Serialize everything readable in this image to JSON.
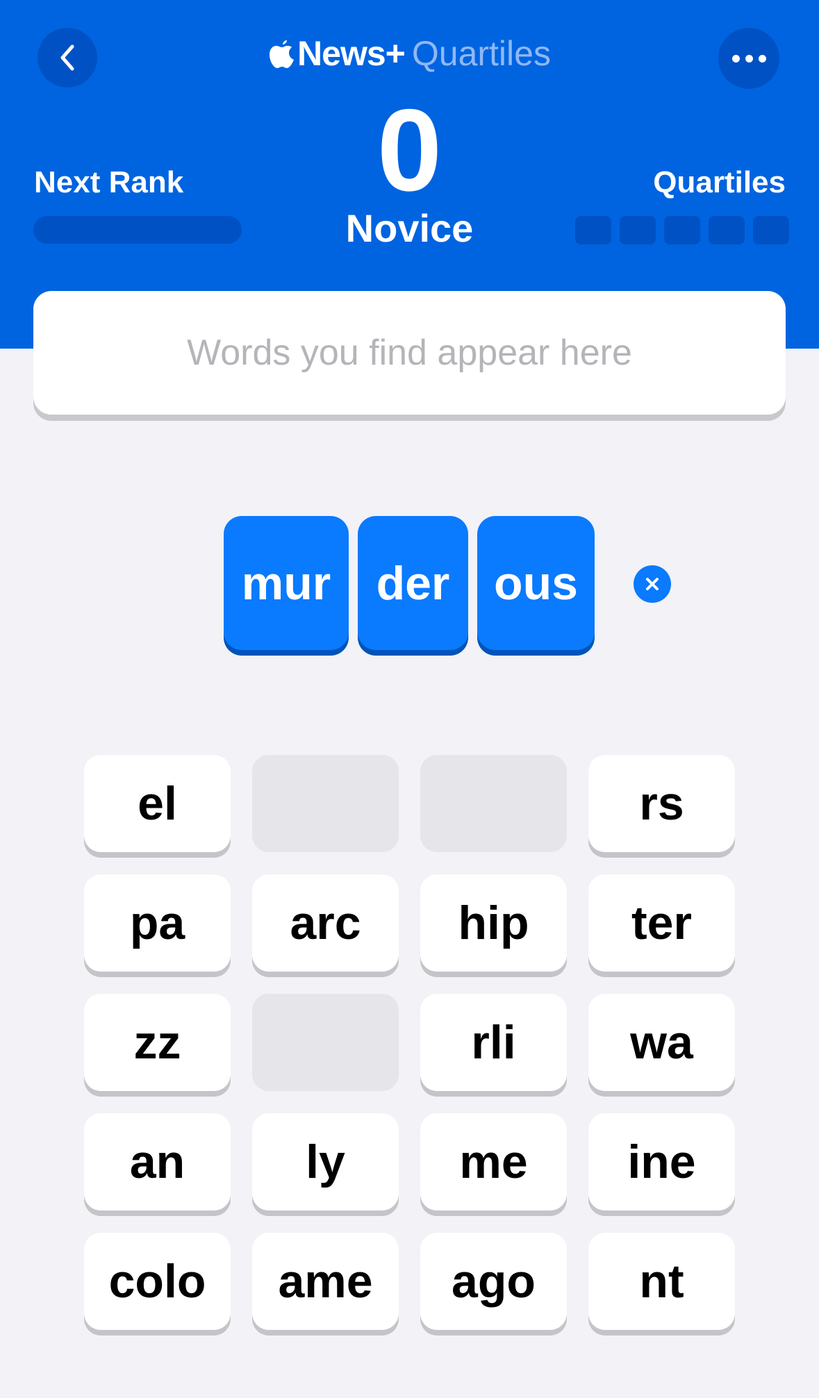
{
  "header": {
    "brand_news": "News+",
    "brand_game": "Quartiles",
    "score": "0",
    "rank": "Novice",
    "next_rank_label": "Next Rank",
    "next_rank_progress": 0,
    "quartiles_label": "Quartiles",
    "quartiles_found": 0,
    "quartiles_total": 5
  },
  "found_words": {
    "placeholder": "Words you find appear here"
  },
  "selection": [
    "mur",
    "der",
    "ous"
  ],
  "tiles": [
    "el",
    "",
    "",
    "rs",
    "pa",
    "arc",
    "hip",
    "ter",
    "zz",
    "",
    "rli",
    "wa",
    "an",
    "ly",
    "me",
    "ine",
    "colo",
    "ame",
    "ago",
    "nt"
  ],
  "colors": {
    "header_bg": "#0064e0",
    "accent": "#0a7aff",
    "tile_bg": "#ffffff",
    "empty_tile_bg": "#e5e5ea",
    "page_bg": "#f2f2f7"
  },
  "icons": {
    "back": "chevron-left-icon",
    "more": "ellipsis-icon",
    "clear": "close-circle-icon",
    "brand": "apple-logo-icon"
  }
}
